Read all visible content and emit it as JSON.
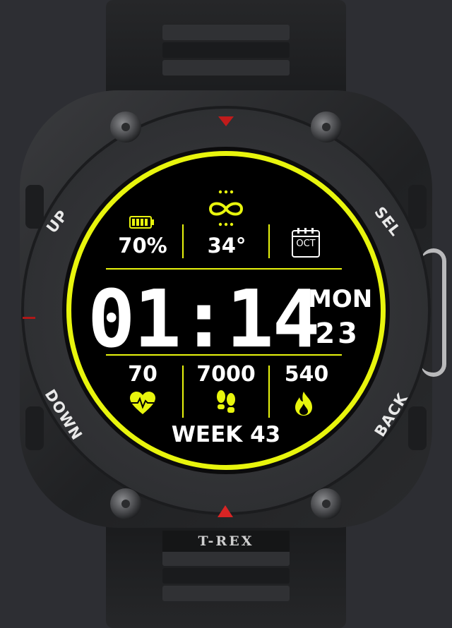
{
  "watch": {
    "brand": "T-REX",
    "bezel_labels": {
      "up": "UP",
      "sel": "SEL",
      "down": "DOWN",
      "back": "BACK"
    }
  },
  "dial": {
    "battery": "70%",
    "temperature": "34°",
    "calendar_month": "OCT",
    "time": "01:14",
    "weekday": "MON",
    "day": "23",
    "heart_rate": "70",
    "steps": "7000",
    "calories": "540",
    "week": "WEEK 43"
  },
  "colors": {
    "accent": "#e8f50d",
    "alert": "#d82424"
  },
  "icons": [
    "battery-icon",
    "infinity-icon",
    "calendar-icon",
    "heart-rate-icon",
    "footsteps-icon",
    "flame-icon"
  ]
}
